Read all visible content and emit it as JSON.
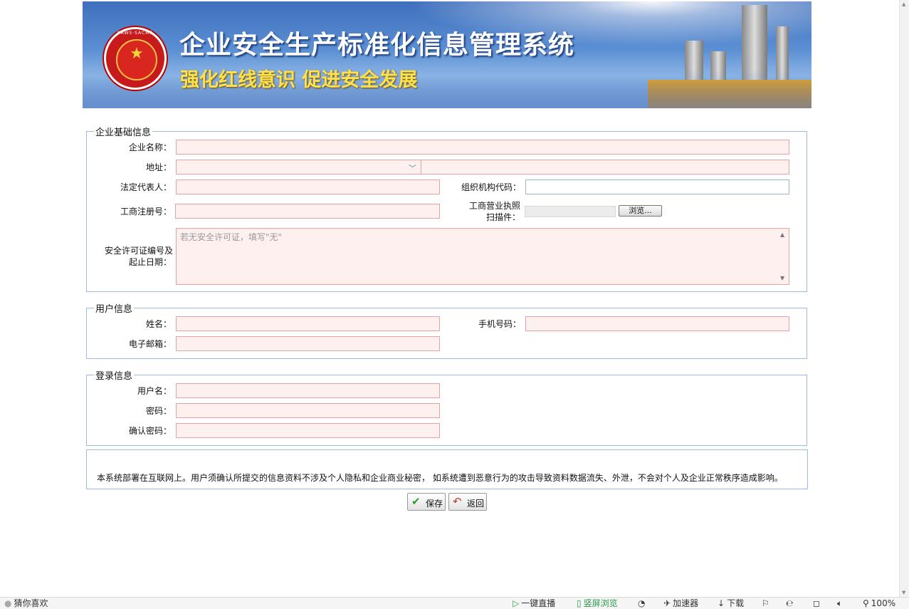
{
  "banner": {
    "title": "企业安全生产标准化信息管理系统",
    "slogan": "强化红线意识 促进安全发展",
    "seal_text": "SAWS·SACMS"
  },
  "sections": {
    "enterprise": {
      "legend": "企业基础信息",
      "name_label": "企业名称：",
      "address_label": "地址：",
      "legal_rep_label": "法定代表人：",
      "org_code_label": "组织机构代码：",
      "reg_no_label": "工商注册号：",
      "license_label_1": "工商营业执照",
      "license_label_2": "扫描件：",
      "browse_label": "浏览...",
      "permit_label_1": "安全许可证编号及",
      "permit_label_2": "起止日期：",
      "permit_placeholder": "若无安全许可证，填写\"无\""
    },
    "user": {
      "legend": "用户信息",
      "name_label": "姓名：",
      "phone_label": "手机号码：",
      "email_label": "电子邮箱："
    },
    "login": {
      "legend": "登录信息",
      "username_label": "用户名：",
      "password_label": "密码：",
      "confirm_label": "确认密码："
    }
  },
  "notice": "本系统部署在互联网上。用户须确认所提交的信息资料不涉及个人隐私和企业商业秘密， 如系统遭到恶意行为的攻击导致资料数据流失、外泄，不会对个人及企业正常秩序造成影响。",
  "buttons": {
    "save": "保存",
    "back": "返回"
  },
  "statusbar": {
    "guess": "猜你喜欢",
    "live": "一键直播",
    "vertical": "竖屏浏览",
    "accelerator": "加速器",
    "download": "下载",
    "zoom": "100%"
  },
  "colors": {
    "required_bg": "#fff0f0",
    "required_border": "#e7a3a3",
    "fieldset_border": "#9dbbe0"
  }
}
